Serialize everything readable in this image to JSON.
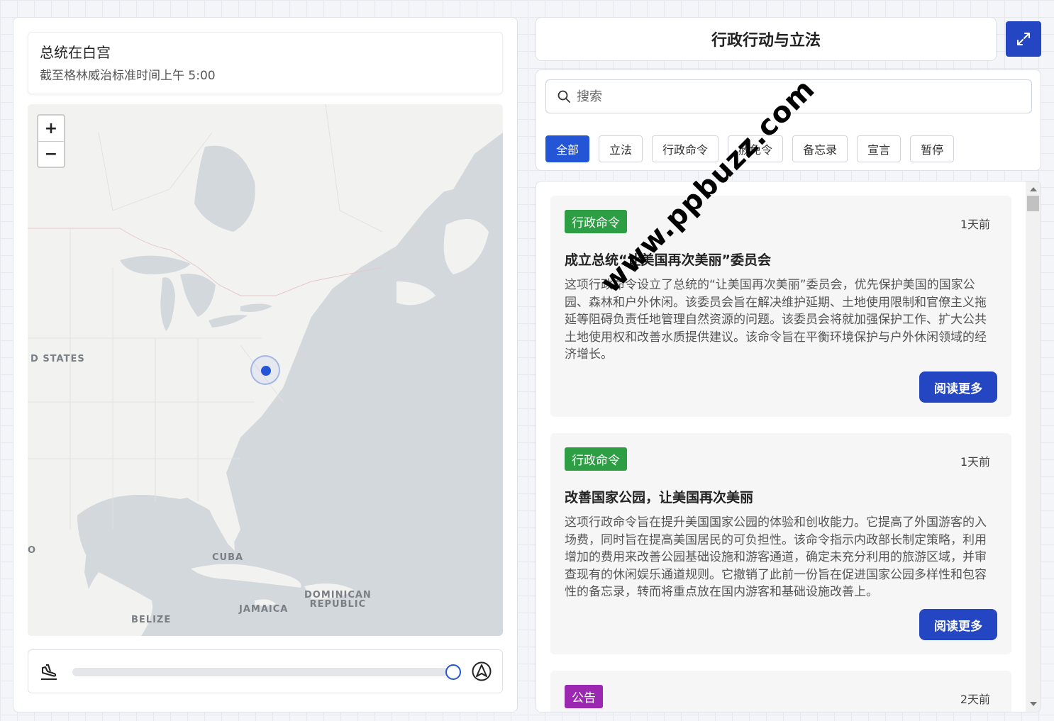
{
  "left": {
    "status_title": "总统在白宫",
    "status_subtitle": "截至格林威治标准时间上午 5:00",
    "zoom_in": "+",
    "zoom_out": "−",
    "map_labels": {
      "us": "D STATES",
      "cuba": "CUBA",
      "jamaica": "JAMAICA",
      "dominican": "DOMINICAN\nREPUBLIC",
      "belize": "BELIZE",
      "edge": "O"
    },
    "timeline": {
      "start_icon": "plane-landing-icon",
      "end_icon": "navigation-arrow-icon",
      "progress": 1.0
    }
  },
  "right": {
    "header_title": "行政行动与立法",
    "expand_icon": "expand-icon",
    "search_placeholder": "搜索",
    "filters": [
      "全部",
      "立法",
      "行政命令",
      "赦免令",
      "备忘录",
      "宣言",
      "暂停"
    ],
    "active_filter": "全部",
    "items": [
      {
        "tag": "行政命令",
        "tag_color": "#2e9e45",
        "time": "1天前",
        "title": "成立总统“让美国再次美丽”委员会",
        "body": "这项行政命令设立了总统的“让美国再次美丽”委员会，优先保护美国的国家公园、森林和户外休闲。该委员会旨在解决维护延期、土地使用限制和官僚主义拖延等阻碍负责任地管理自然资源的问题。该委员会将就加强保护工作、扩大公共土地使用权和改善水质提供建议。该命令旨在平衡环境保护与户外休闲领域的经济增长。",
        "button": "阅读更多"
      },
      {
        "tag": "行政命令",
        "tag_color": "#2e9e45",
        "time": "1天前",
        "title": "改善国家公园，让美国再次美丽",
        "body": "这项行政命令旨在提升美国国家公园的体验和创收能力。它提高了外国游客的入场费，同时旨在提高美国居民的可负担性。该命令指示内政部长制定策略，利用增加的费用来改善公园基础设施和游客通道，确定未充分利用的旅游区域，并审查现有的休闲娱乐通道规则。它撤销了此前一份旨在促进国家公园多样性和包容性的备忘录，转而将重点放在国内游客和基础设施改善上。",
        "button": "阅读更多"
      },
      {
        "tag": "公告",
        "tag_color": "#9c27b0",
        "time": "2天前",
        "title": "",
        "body": "",
        "button": ""
      }
    ]
  },
  "watermark": "www.ppbuzz.com"
}
